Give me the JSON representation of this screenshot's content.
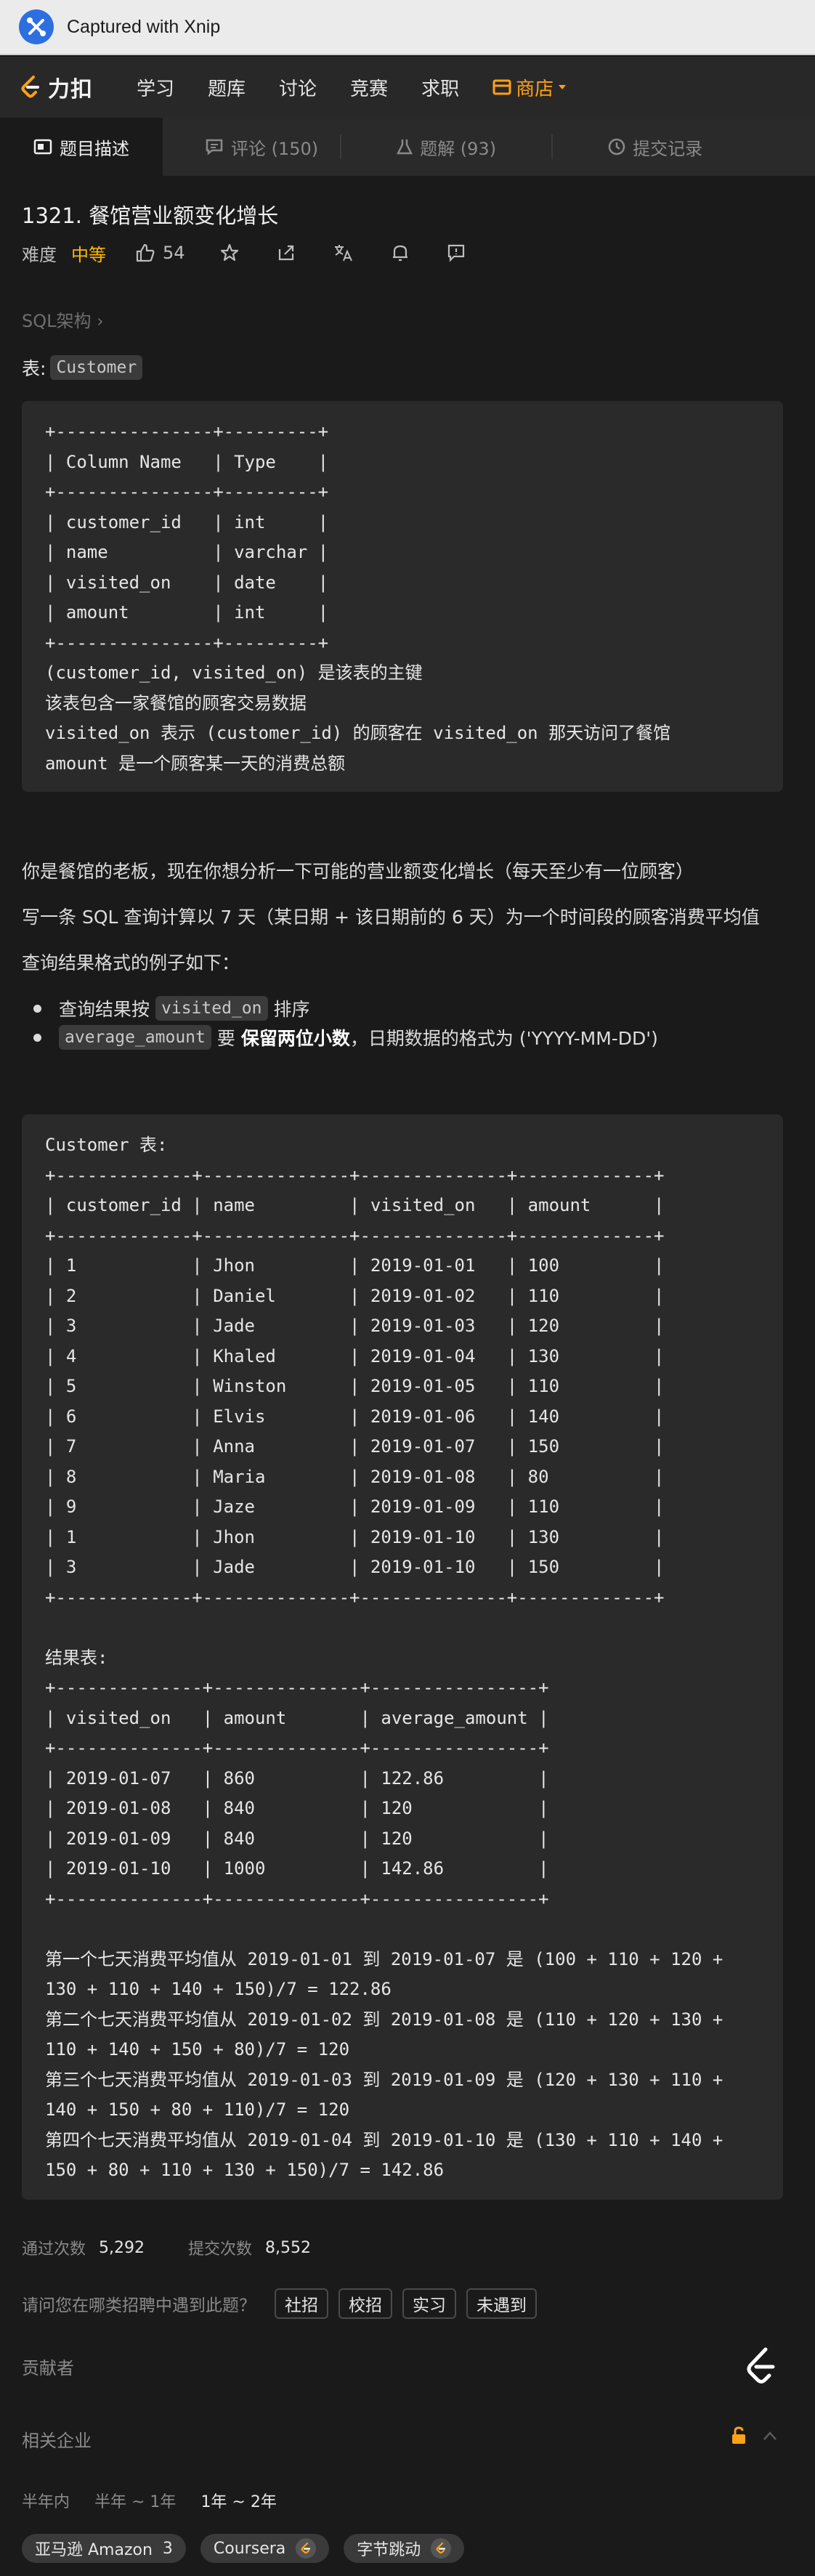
{
  "capture": {
    "text": "Captured with Xnip"
  },
  "nav": {
    "brand": "力扣",
    "items": [
      "学习",
      "题库",
      "讨论",
      "竞赛",
      "求职"
    ],
    "store": "商店"
  },
  "tabs": [
    {
      "label": "题目描述"
    },
    {
      "label": "评论 (150)"
    },
    {
      "label": "题解 (93)"
    },
    {
      "label": "提交记录"
    }
  ],
  "problem": {
    "title": "1321. 餐馆营业额变化增长",
    "difficulty_label": "难度",
    "difficulty": "中等",
    "likes": "54",
    "breadcrumb": "SQL架构 ›",
    "table_label": "表:",
    "table_name": "Customer"
  },
  "schema_block": "+---------------+---------+\n| Column Name   | Type    |\n+---------------+---------+\n| customer_id   | int     |\n| name          | varchar |\n| visited_on    | date    |\n| amount        | int     |\n+---------------+---------+\n(customer_id, visited_on) 是该表的主键\n该表包含一家餐馆的顾客交易数据\nvisited_on 表示 (customer_id) 的顾客在 visited_on 那天访问了餐馆\namount 是一个顾客某一天的消费总额",
  "description": {
    "p1": "你是餐馆的老板，现在你想分析一下可能的营业额变化增长（每天至少有一位顾客）",
    "p2": "写一条 SQL 查询计算以 7 天（某日期 + 该日期前的 6 天）为一个时间段的顾客消费平均值",
    "p3": "查询结果格式的例子如下：",
    "b1_prefix": "查询结果按",
    "b1_code": "visited_on",
    "b1_suffix": "排序",
    "b2_code": "average_amount",
    "b2_mid": "要",
    "b2_bold": "保留两位小数",
    "b2_suffix": "，日期数据的格式为 ('YYYY-MM-DD')"
  },
  "example_block": "Customer 表:\n+-------------+--------------+--------------+-------------+\n| customer_id | name         | visited_on   | amount      |\n+-------------+--------------+--------------+-------------+\n| 1           | Jhon         | 2019-01-01   | 100         |\n| 2           | Daniel       | 2019-01-02   | 110         |\n| 3           | Jade         | 2019-01-03   | 120         |\n| 4           | Khaled       | 2019-01-04   | 130         |\n| 5           | Winston      | 2019-01-05   | 110         |\n| 6           | Elvis        | 2019-01-06   | 140         |\n| 7           | Anna         | 2019-01-07   | 150         |\n| 8           | Maria        | 2019-01-08   | 80          |\n| 9           | Jaze         | 2019-01-09   | 110         |\n| 1           | Jhon         | 2019-01-10   | 130         |\n| 3           | Jade         | 2019-01-10   | 150         |\n+-------------+--------------+--------------+-------------+\n\n结果表:\n+--------------+--------------+----------------+\n| visited_on   | amount       | average_amount |\n+--------------+--------------+----------------+\n| 2019-01-07   | 860          | 122.86         |\n| 2019-01-08   | 840          | 120            |\n| 2019-01-09   | 840          | 120            |\n| 2019-01-10   | 1000         | 142.86         |\n+--------------+--------------+----------------+\n\n第一个七天消费平均值从 2019-01-01 到 2019-01-07 是 (100 + 110 + 120 +\n130 + 110 + 140 + 150)/7 = 122.86\n第二个七天消费平均值从 2019-01-02 到 2019-01-08 是 (110 + 120 + 130 +\n110 + 140 + 150 + 80)/7 = 120\n第三个七天消费平均值从 2019-01-03 到 2019-01-09 是 (120 + 130 + 110 +\n140 + 150 + 80 + 110)/7 = 120\n第四个七天消费平均值从 2019-01-04 到 2019-01-10 是 (130 + 110 + 140 +\n150 + 80 + 110 + 130 + 150)/7 = 142.86",
  "stats": {
    "accepted_label": "通过次数",
    "accepted": "5,292",
    "submitted_label": "提交次数",
    "submitted": "8,552"
  },
  "recruit": {
    "question": "请问您在哪类招聘中遇到此题？",
    "options": [
      "社招",
      "校招",
      "实习",
      "未遇到"
    ]
  },
  "contributors_label": "贡献者",
  "related_label": "相关企业",
  "periods": [
    "半年内",
    "半年 ~ 1年",
    "1年 ~ 2年"
  ],
  "companies": [
    {
      "name": "亚马逊 Amazon",
      "count": "3"
    },
    {
      "name": "Coursera",
      "count": ""
    },
    {
      "name": "字节跳动",
      "count": ""
    }
  ],
  "colors": {
    "accent": "#ffa116",
    "medium": "#ffb800",
    "bg": "#1a1a1a"
  }
}
